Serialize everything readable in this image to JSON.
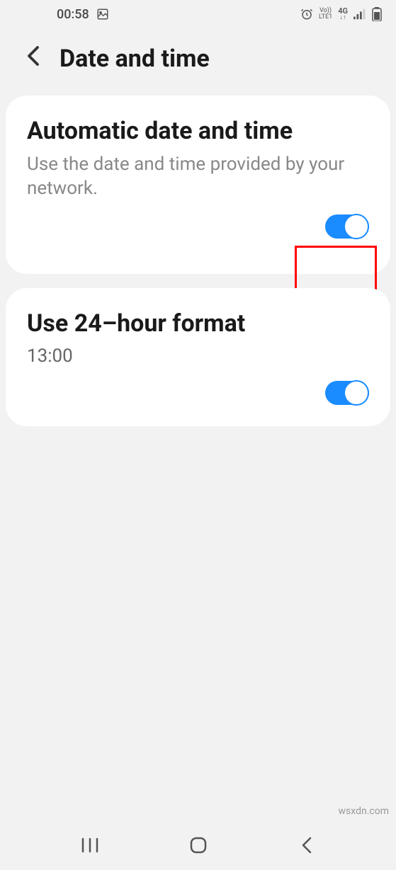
{
  "statusbar": {
    "time": "00:58",
    "network_label_top": "Vo))",
    "network_label_bottom": "LTE1",
    "network_type": "4G"
  },
  "header": {
    "title": "Date and time"
  },
  "settings": {
    "auto": {
      "title": "Automatic date and time",
      "desc": "Use the date and time provided by your network.",
      "enabled": true
    },
    "format24": {
      "title": "Use 24–hour format",
      "example": "13:00",
      "enabled": true
    }
  },
  "watermark": "wsxdn.com"
}
